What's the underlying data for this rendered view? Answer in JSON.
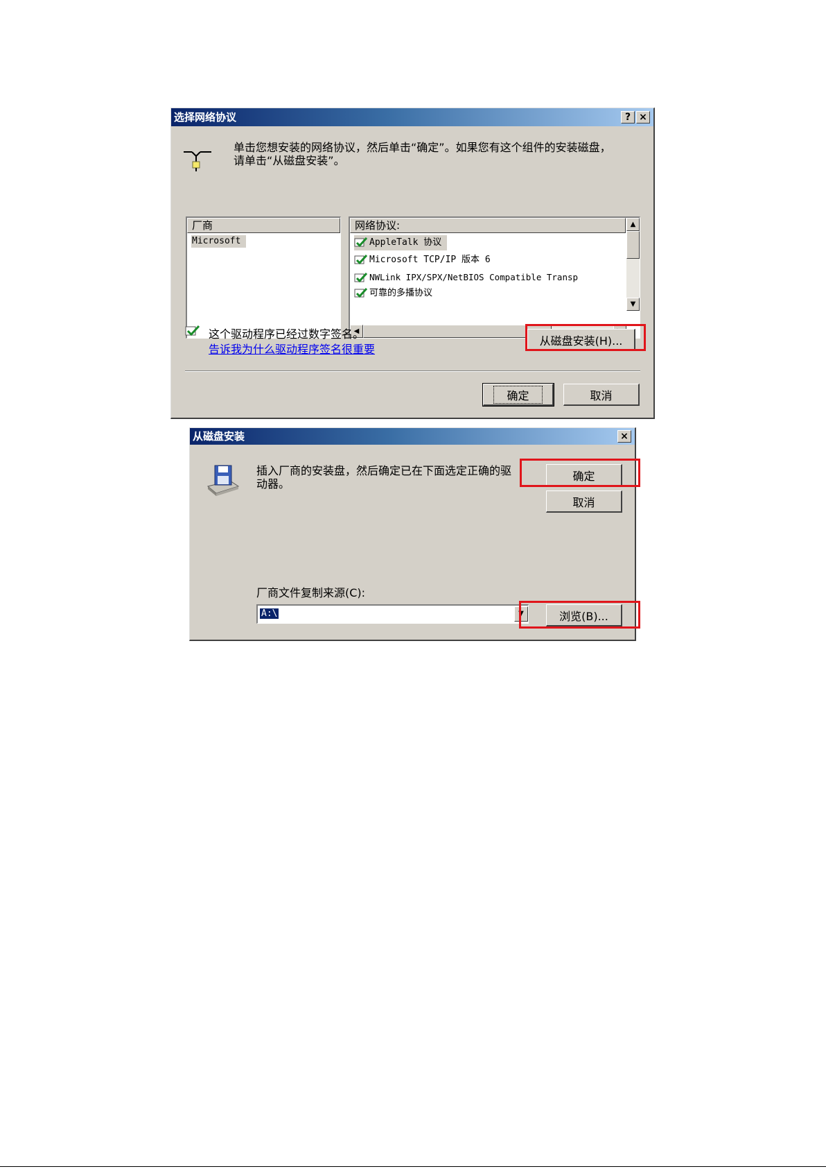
{
  "dialog1": {
    "title": "选择网络协议",
    "help_button": "?",
    "close_button": "×",
    "instruction": "单击您想安装的网络协议，然后单击“确定”。如果您有这个组件的安装磁盘，请单击“从磁盘安装”。",
    "manufacturer_header": "厂商",
    "manufacturers": [
      "Microsoft"
    ],
    "protocol_header": "网络协议:",
    "protocols": [
      "AppleTalk 协议",
      "Microsoft TCP/IP 版本 6",
      "NWLink IPX/SPX/NetBIOS Compatible Transp",
      "可靠的多播协议"
    ],
    "signed_text": "这个驱动程序已经过数字签名。",
    "signed_link": "告诉我为什么驱动程序签名很重要",
    "have_disk_button": "从磁盘安装(H)...",
    "ok_button": "确定",
    "cancel_button": "取消"
  },
  "dialog2": {
    "title": "从磁盘安装",
    "close_button": "×",
    "instruction": "插入厂商的安装盘，然后确定已在下面选定正确的驱动器。",
    "ok_button": "确定",
    "cancel_button": "取消",
    "copy_from_label": "厂商文件复制来源(C):",
    "copy_from_value": "A:\\",
    "browse_button": "浏览(B)..."
  },
  "annotation_color": "#e0151b"
}
